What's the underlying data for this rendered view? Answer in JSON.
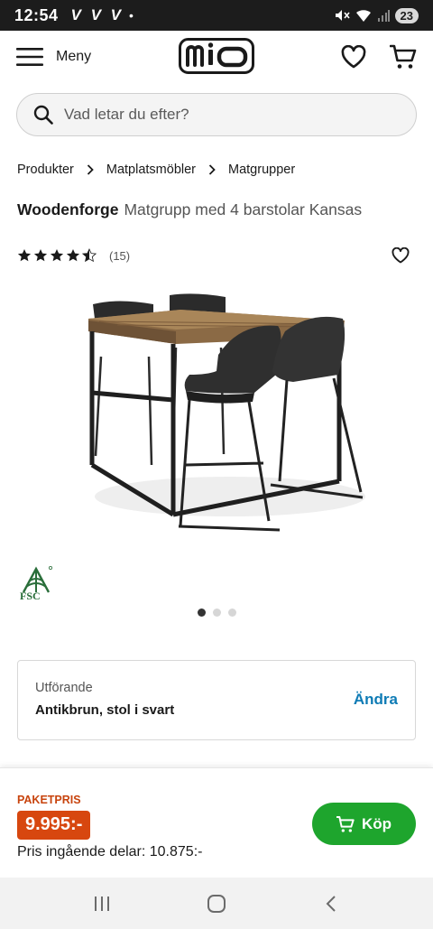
{
  "status_bar": {
    "time": "12:54",
    "notifications": "V V V",
    "dot": "•",
    "battery": "23"
  },
  "header": {
    "menu_label": "Meny",
    "logo_text": "MIO",
    "icons": [
      "menu-icon",
      "heart-icon",
      "cart-icon"
    ]
  },
  "search": {
    "placeholder": "Vad letar du efter?"
  },
  "breadcrumb": [
    "Produkter",
    "Matplatsmöbler",
    "Matgrupper"
  ],
  "product": {
    "brand": "Woodenforge",
    "name": "Matgrupp med 4 barstolar Kansas",
    "rating": 4.5,
    "review_count": "(15)",
    "certification": "FSC",
    "image_count": 3,
    "active_image": 0
  },
  "variant": {
    "label": "Utförande",
    "value": "Antikbrun, stol i svart",
    "change_label": "Ändra"
  },
  "purchase": {
    "package_label": "PAKETPRIS",
    "price": "9.995:-",
    "parts_price": "Pris ingående delar: 10.875:-",
    "buy_label": "Köp"
  },
  "colors": {
    "accent_orange": "#d7470f",
    "buy_green": "#1ea52d",
    "link_blue": "#0e7bb5",
    "fsc_green": "#2a6e3a"
  }
}
